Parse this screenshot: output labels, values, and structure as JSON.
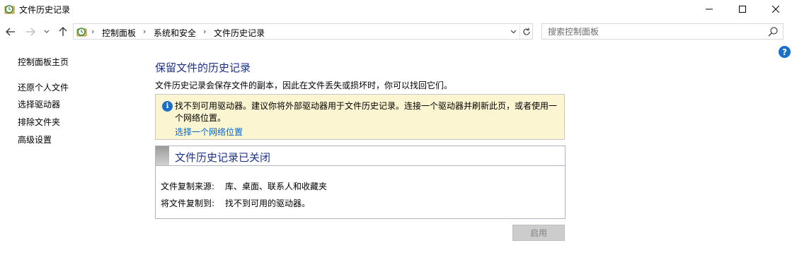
{
  "window": {
    "title": "文件历史记录"
  },
  "nav": {
    "breadcrumbs": [
      "控制面板",
      "系统和安全",
      "文件历史记录"
    ]
  },
  "search": {
    "placeholder": "搜索控制面板"
  },
  "sidebar": {
    "items": [
      {
        "label": "控制面板主页"
      },
      {
        "label": "还原个人文件"
      },
      {
        "label": "选择驱动器"
      },
      {
        "label": "排除文件夹"
      },
      {
        "label": "高级设置"
      }
    ]
  },
  "main": {
    "title": "保留文件的历史记录",
    "description": "文件历史记录会保存文件的副本，因此在文件丢失或损坏时，你可以找回它们。",
    "warning": {
      "text": "找不到可用驱动器。建议你将外部驱动器用于文件历史记录。连接一个驱动器并刷新此页，或者使用一个网络位置。",
      "link": "选择一个网络位置"
    },
    "status": {
      "title": "文件历史记录已关闭",
      "rows": [
        {
          "label": "文件复制来源:",
          "value": "库、桌面、联系人和收藏夹"
        },
        {
          "label": "将文件复制到:",
          "value": "找不到可用的驱动器。"
        }
      ]
    },
    "enable_button": "启用"
  },
  "colors": {
    "accent_title": "#1e3287",
    "link": "#0066cc",
    "warning_bg": "#fbf6d1",
    "info_blue": "#1a6fc9"
  }
}
